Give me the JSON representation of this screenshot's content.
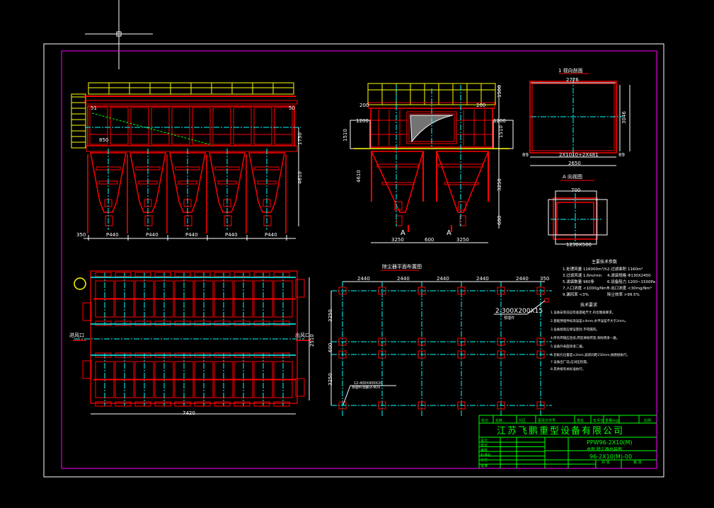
{
  "colors": {
    "background": "#000000",
    "frame": "#ffffff",
    "margin": "#ff00ff",
    "structure": "#ff0000",
    "centerline": "#00ffff",
    "railing": "#ffff00",
    "titleblock": "#00ff00",
    "dimension": "#ffffff"
  },
  "front_view": {
    "dims": {
      "pitch": [
        "P440",
        "P440",
        "P440",
        "P440",
        "P440"
      ],
      "left": "350",
      "top_left": "51",
      "top_right": "50",
      "inner": "850",
      "right_upper": "1750",
      "right_lower": "4610"
    }
  },
  "side_view": {
    "dims": {
      "bottom": [
        "3250",
        "600",
        "3250"
      ],
      "top_left": "200",
      "top_right": "200",
      "left_a": "1200",
      "left_b": "1510",
      "right_a": "1200",
      "right_b": "1510",
      "right_top": "1500",
      "right_mid": "3250",
      "right_low": "600",
      "left_mid": "4610"
    },
    "section_marks": [
      "A",
      "A"
    ]
  },
  "section_1": {
    "title": "1 视向剖面",
    "dims": {
      "top": "2776",
      "bottom_inner": "2X1010+2X481",
      "bottom": "2650",
      "left": "89",
      "right": "89",
      "side": "3046"
    }
  },
  "section_a": {
    "title": "A 向视图",
    "dims": {
      "top": "700",
      "bottom": "1250X500"
    }
  },
  "plan_view": {
    "dims": {
      "length": "7420",
      "width": "2510"
    },
    "inlet_label": "进风口",
    "outlet_label": "出风口"
  },
  "foundation": {
    "title": "除尘器平面布置图",
    "top_dims": [
      "2440",
      "2440",
      "2440",
      "2440",
      "2440",
      "350"
    ],
    "left_dims": [
      "3250",
      "600",
      "3250"
    ],
    "callout_plate": "2-300X200X15",
    "callout_plate_note": "预埋件",
    "callout_base": "12-400X400X20",
    "callout_base_note": "预埋件(地脚)4-M24"
  },
  "specs": {
    "title": "主要技术参数",
    "items": [
      "1.处理风量 116000m³/h",
      "2.过滤面积 1160m²",
      "3.过滤风速 1.6m/min",
      "4.滤袋规格 Φ130X2450",
      "5.滤袋数量 960条",
      "6.设备阻力 1200~1500Pa",
      "7.入口浓度 <1000g/Nm³",
      "8.出口浓度 <30mg/Nm³",
      "9.漏风率 <3%",
      "除尘效率 >99.5%"
    ]
  },
  "notes": {
    "title": "技术要求",
    "items": [
      "1.设备安装前应检查基础尺寸,符合图纸要求。",
      "2.基础预埋件标高误差±4mm,水平误差不大于2mm。",
      "3.设备组装应保证密封,不得漏风。",
      "4.所有焊缝应连续,焊后清除焊渣,涂防锈漆一遍。",
      "5.设备外表面涂漆二遍。",
      "6.花板孔位置度±2mm,滤袋间距150mm,按图纸执行。",
      "7.设备出厂前,应试压检漏。",
      "8.其余按有关标准执行。"
    ]
  },
  "title_block": {
    "header": [
      "标记",
      "处数",
      "分区",
      "更改文件号",
      "签名",
      "年月日",
      "重量(kg)",
      "比例"
    ],
    "company": "江苏飞鹏重型设备有限公司",
    "model": "PPW96-2X10(M)",
    "drawing_name": "总图 除尘器总装图",
    "drawing_no": "96-2X10(M)-00",
    "roles": [
      "设计",
      "校对",
      "审核",
      "标准化",
      "工艺",
      "批准"
    ],
    "footer": [
      "共 张",
      "第 张"
    ]
  }
}
